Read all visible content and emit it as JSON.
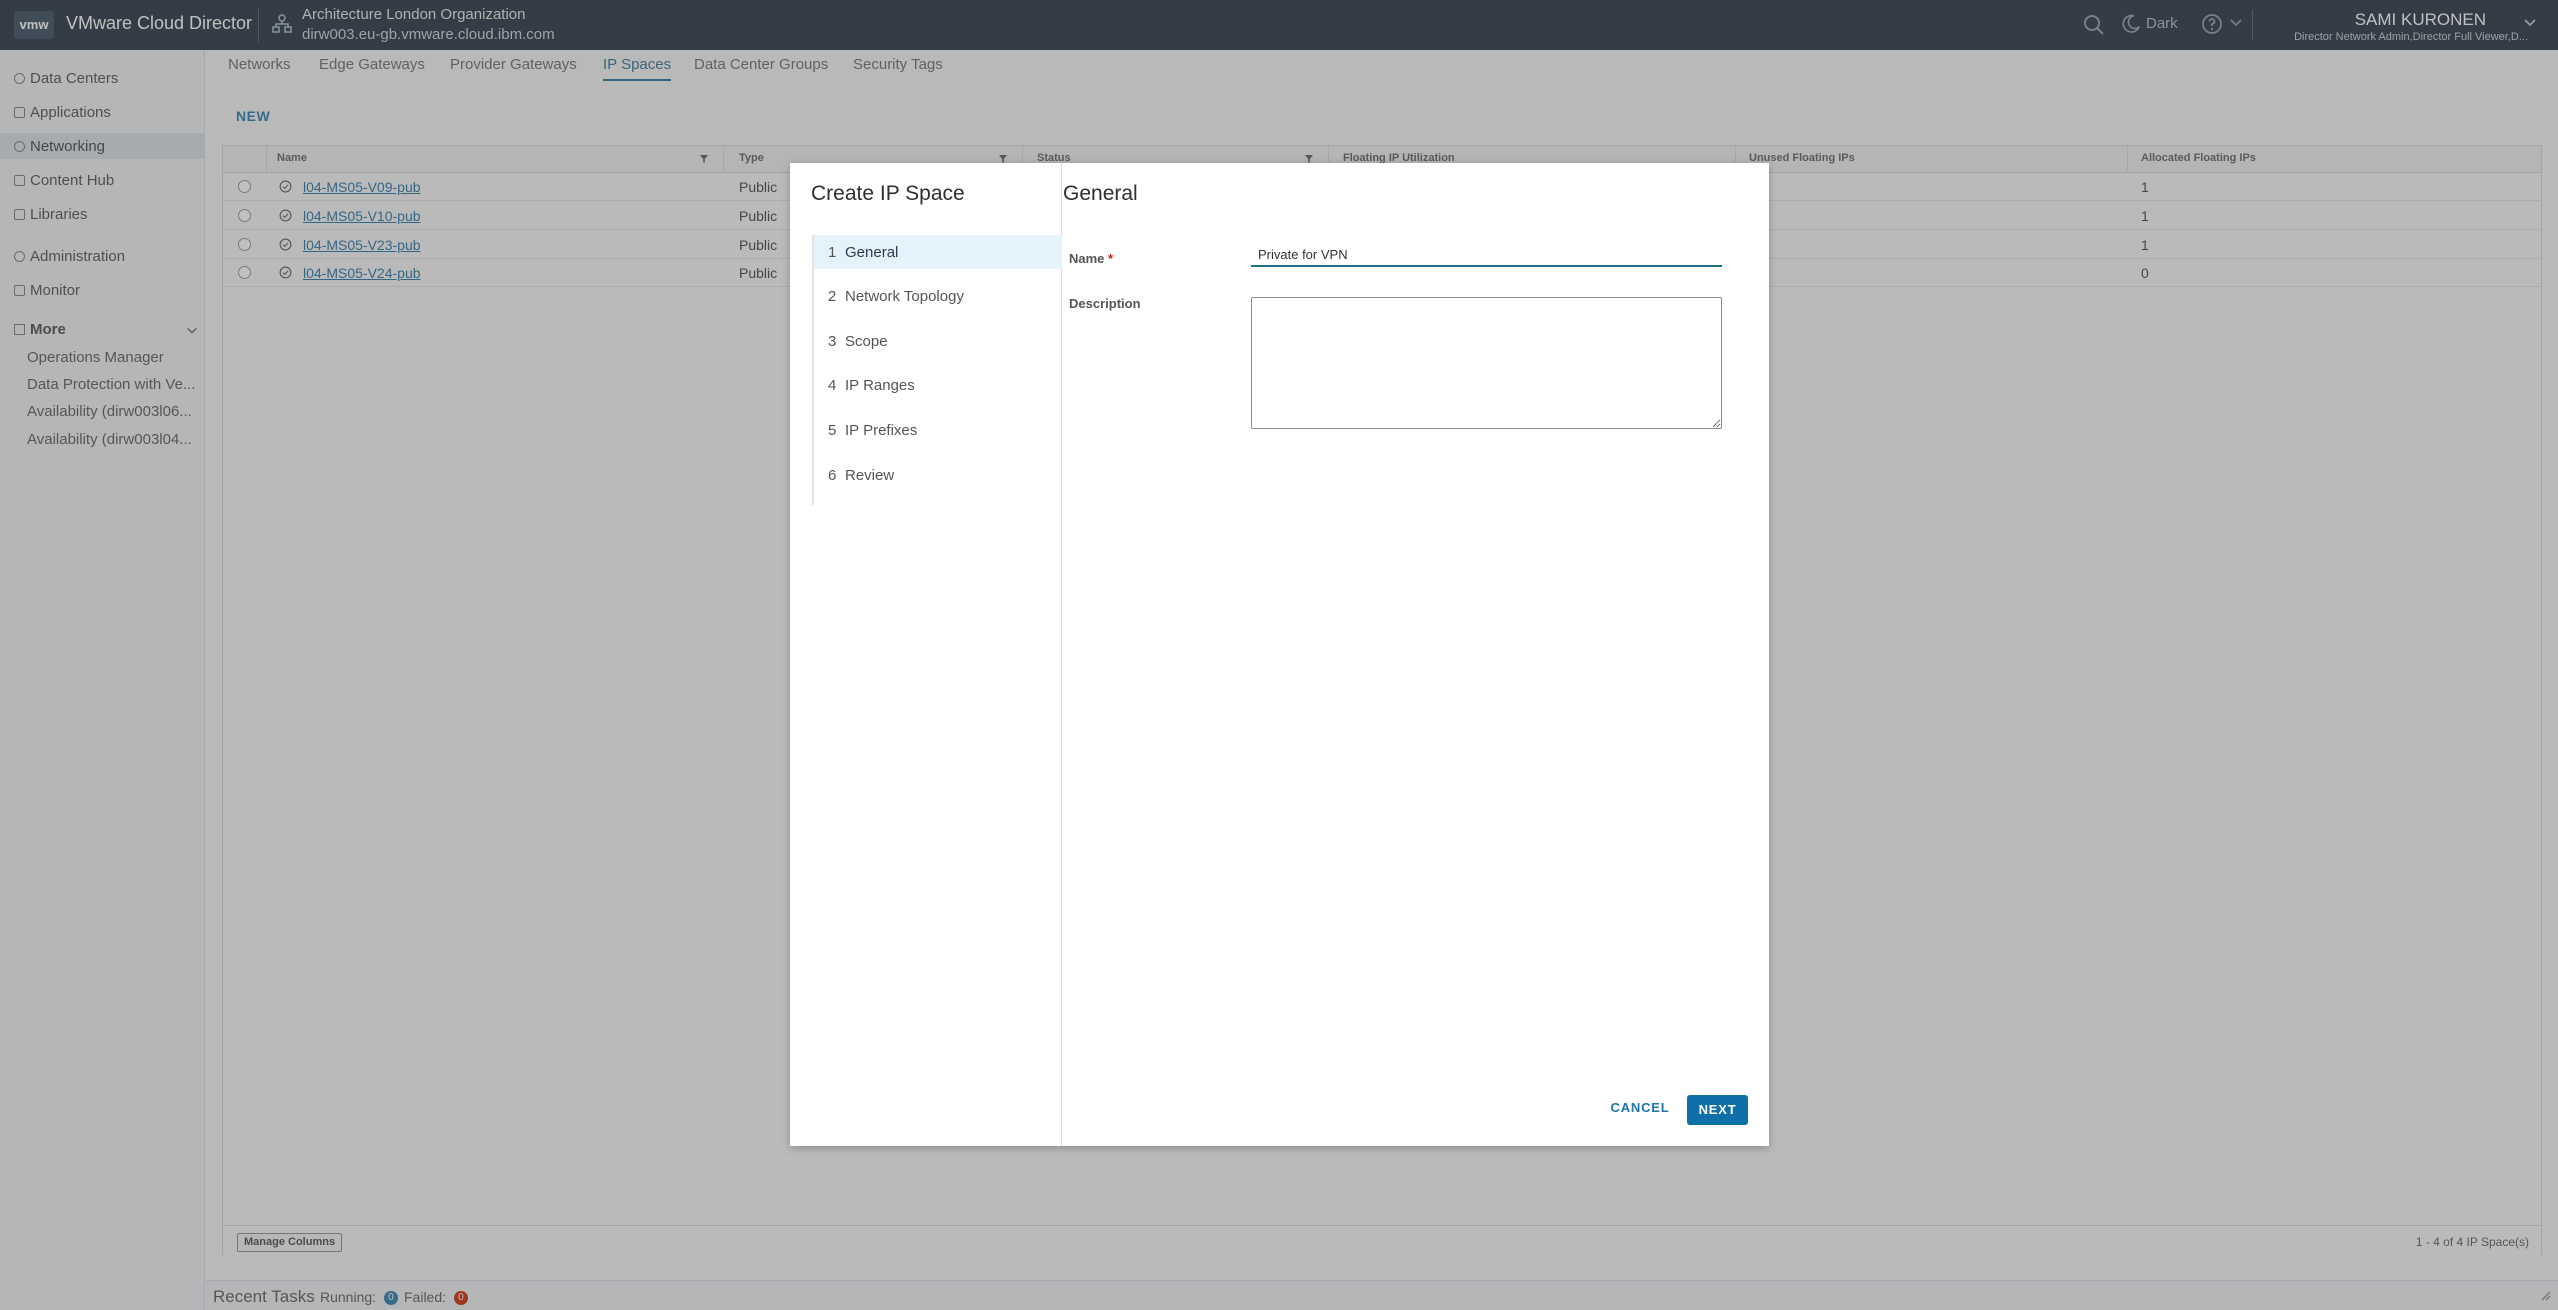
{
  "header": {
    "logo": "vmw",
    "app_title": "VMware Cloud Director",
    "org_name": "Architecture London Organization",
    "org_host": "dirw003.eu-gb.vmware.cloud.ibm.com",
    "theme_label": "Dark",
    "user_name": "SAMI KURONEN",
    "user_roles": "Director Network Admin,Director Full Viewer,D..."
  },
  "sidebar": {
    "items": [
      {
        "label": "Data Centers",
        "icon": "data-centers-icon"
      },
      {
        "label": "Applications",
        "icon": "applications-icon"
      },
      {
        "label": "Networking",
        "icon": "networking-icon",
        "active": true
      },
      {
        "label": "Content Hub",
        "icon": "content-hub-icon"
      },
      {
        "label": "Libraries",
        "icon": "libraries-icon"
      },
      {
        "label": "Administration",
        "icon": "administration-icon"
      },
      {
        "label": "Monitor",
        "icon": "monitor-icon"
      }
    ],
    "more_label": "More",
    "more_items": [
      "Operations Manager",
      "Data Protection with Ve...",
      "Availability (dirw003l06...",
      "Availability (dirw003l04..."
    ]
  },
  "tabs": [
    "Networks",
    "Edge Gateways",
    "Provider Gateways",
    "IP Spaces",
    "Data Center Groups",
    "Security Tags"
  ],
  "active_tab": "IP Spaces",
  "new_button": "NEW",
  "grid": {
    "columns": [
      "Name",
      "Type",
      "Status",
      "Floating IP Utilization",
      "Unused Floating IPs",
      "Allocated Floating IPs"
    ],
    "rows": [
      {
        "name": "l04-MS05-V09-pub",
        "type": "Public",
        "allocated": "1"
      },
      {
        "name": "l04-MS05-V10-pub",
        "type": "Public",
        "allocated": "1"
      },
      {
        "name": "l04-MS05-V23-pub",
        "type": "Public",
        "allocated": "1"
      },
      {
        "name": "l04-MS05-V24-pub",
        "type": "Public",
        "allocated": "0"
      }
    ],
    "manage_columns": "Manage Columns",
    "pager": "1 - 4 of 4 IP Space(s)"
  },
  "recent_tasks": {
    "title": "Recent Tasks",
    "running_label": "Running:",
    "running_count": "0",
    "failed_label": "Failed:",
    "failed_count": "0",
    "colors": {
      "running": "#1f75a8",
      "failed": "#c92100"
    }
  },
  "wizard": {
    "title": "Create IP Space",
    "steps": [
      {
        "num": "1",
        "label": "General",
        "active": true
      },
      {
        "num": "2",
        "label": "Network Topology"
      },
      {
        "num": "3",
        "label": "Scope"
      },
      {
        "num": "4",
        "label": "IP Ranges"
      },
      {
        "num": "5",
        "label": "IP Prefixes"
      },
      {
        "num": "6",
        "label": "Review"
      }
    ],
    "pane_title": "General",
    "name_label": "Name",
    "required_mark": "*",
    "name_value": "Private for VPN",
    "description_label": "Description",
    "description_value": "",
    "cancel_label": "CANCEL",
    "next_label": "NEXT"
  },
  "colors": {
    "header_bg": "#1d2c3a",
    "accent": "#0f6fa8",
    "link": "#1f6e9e"
  }
}
